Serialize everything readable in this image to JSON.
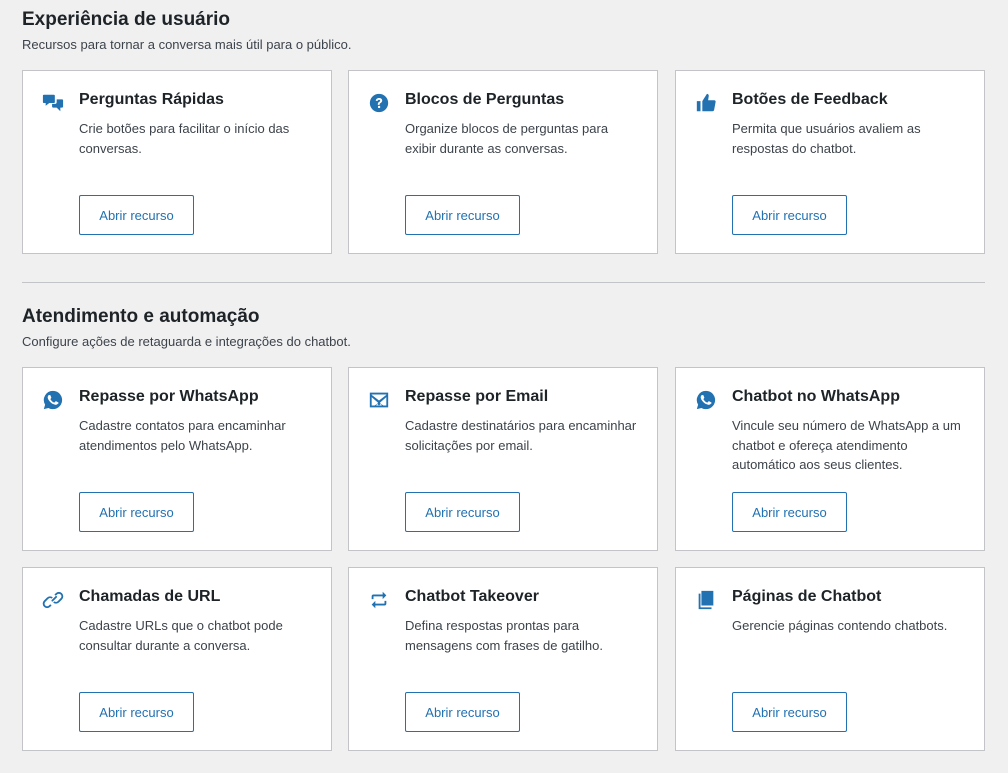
{
  "sections": [
    {
      "title": "Experiência de usuário",
      "description": "Recursos para tornar a conversa mais útil para o público.",
      "cards": [
        {
          "icon": "chat-bubbles-icon",
          "title": "Perguntas Rápidas",
          "description": "Crie botões para facilitar o início das conversas.",
          "button": "Abrir recurso"
        },
        {
          "icon": "question-circle-icon",
          "title": "Blocos de Perguntas",
          "description": "Organize blocos de perguntas para exibir durante as conversas.",
          "button": "Abrir recurso"
        },
        {
          "icon": "thumbs-up-icon",
          "title": "Botões de Feedback",
          "description": "Permita que usuários avaliem as respostas do chatbot.",
          "button": "Abrir recurso"
        }
      ]
    },
    {
      "title": "Atendimento e automação",
      "description": "Configure ações de retaguarda e integrações do chatbot.",
      "cards": [
        {
          "icon": "whatsapp-icon",
          "title": "Repasse por WhatsApp",
          "description": "Cadastre contatos para encaminhar atendimentos pelo WhatsApp.",
          "button": "Abrir recurso"
        },
        {
          "icon": "envelope-icon",
          "title": "Repasse por Email",
          "description": "Cadastre destinatários para encaminhar solicitações por email.",
          "button": "Abrir recurso"
        },
        {
          "icon": "whatsapp-icon",
          "title": "Chatbot no WhatsApp",
          "description": "Vincule seu número de WhatsApp a um chatbot e ofereça atendimento automático aos seus clientes.",
          "button": "Abrir recurso"
        },
        {
          "icon": "link-icon",
          "title": "Chamadas de URL",
          "description": "Cadastre URLs que o chatbot pode consultar durante a conversa.",
          "button": "Abrir recurso"
        },
        {
          "icon": "swap-arrows-icon",
          "title": "Chatbot Takeover",
          "description": "Defina respostas prontas para mensagens com frases de gatilho.",
          "button": "Abrir recurso"
        },
        {
          "icon": "pages-icon",
          "title": "Páginas de Chatbot",
          "description": "Gerencie páginas contendo chatbots.",
          "button": "Abrir recurso"
        }
      ]
    }
  ],
  "colors": {
    "accent": "#2271b1",
    "background": "#f0f0f1",
    "card_border": "#c3c4c7"
  }
}
